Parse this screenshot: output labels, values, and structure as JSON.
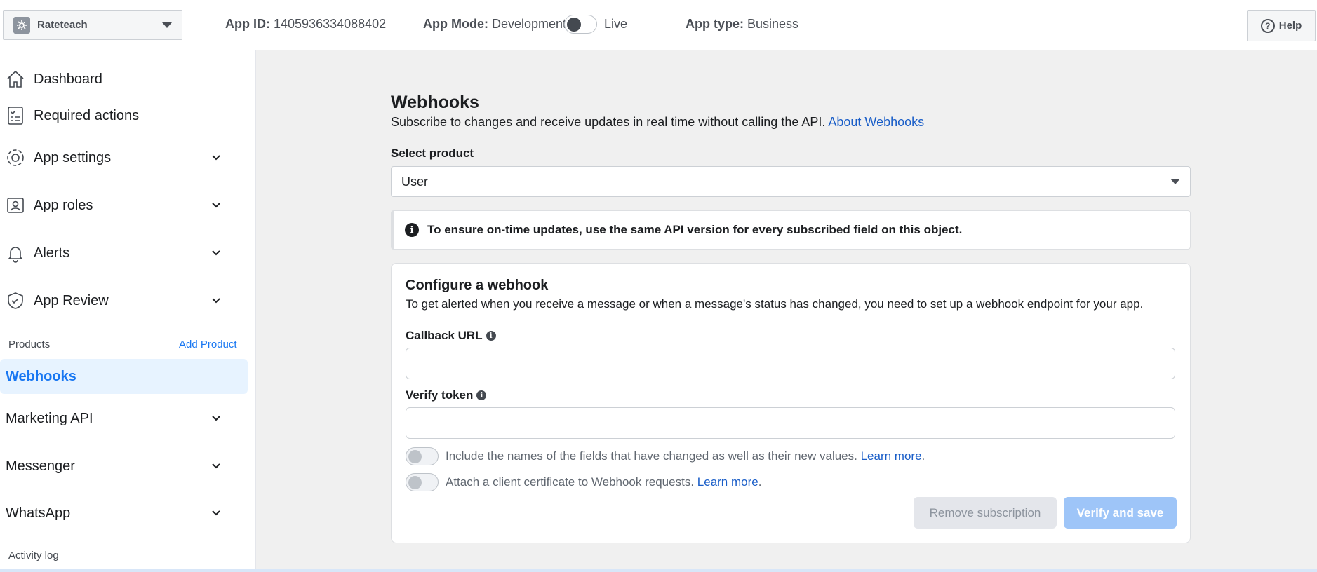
{
  "topbar": {
    "app_name": "Rateteach",
    "app_id_label": "App ID:",
    "app_id": "1405936334088402",
    "app_mode_label": "App Mode:",
    "app_mode_dev": "Development",
    "app_mode_live": "Live",
    "app_type_label": "App type:",
    "app_type": "Business",
    "help_label": "Help"
  },
  "sidebar": {
    "items": [
      {
        "label": "Dashboard",
        "icon": "home-icon"
      },
      {
        "label": "Required actions",
        "icon": "checklist-icon"
      },
      {
        "label": "App settings",
        "icon": "gear-icon"
      },
      {
        "label": "App roles",
        "icon": "badge-icon"
      },
      {
        "label": "Alerts",
        "icon": "bell-icon"
      },
      {
        "label": "App Review",
        "icon": "shield-check-icon"
      }
    ],
    "products_label": "Products",
    "add_product_label": "Add Product",
    "active_item": "Webhooks",
    "product_items": [
      {
        "label": "Marketing API"
      },
      {
        "label": "Messenger"
      },
      {
        "label": "WhatsApp"
      }
    ],
    "activity_log": "Activity log"
  },
  "main": {
    "title": "Webhooks",
    "description": "Subscribe to changes and receive updates in real time without calling the API.",
    "about_link": "About Webhooks",
    "select_product_label": "Select product",
    "select_product_value": "User",
    "info_banner": "To ensure on-time updates, use the same API version for every subscribed field on this object.",
    "card": {
      "title": "Configure a webhook",
      "description": "To get alerted when you receive a message or when a message's status has changed, you need to set up a webhook endpoint for your app.",
      "callback_label": "Callback URL",
      "callback_value": "",
      "verify_label": "Verify token",
      "verify_value": "",
      "toggle1_text": "Include the names of the fields that have changed as well as their new values.",
      "toggle2_text": "Attach a client certificate to Webhook requests.",
      "learn_more": "Learn more",
      "period": ".",
      "remove_label": "Remove subscription",
      "verify_save_label": "Verify and save"
    }
  },
  "colors": {
    "accent": "#1877f2",
    "link": "#1a5ec8",
    "active_bg": "#e7f3ff",
    "main_bg": "#f0f0f0",
    "verify_btn": "#9ec5f8"
  }
}
